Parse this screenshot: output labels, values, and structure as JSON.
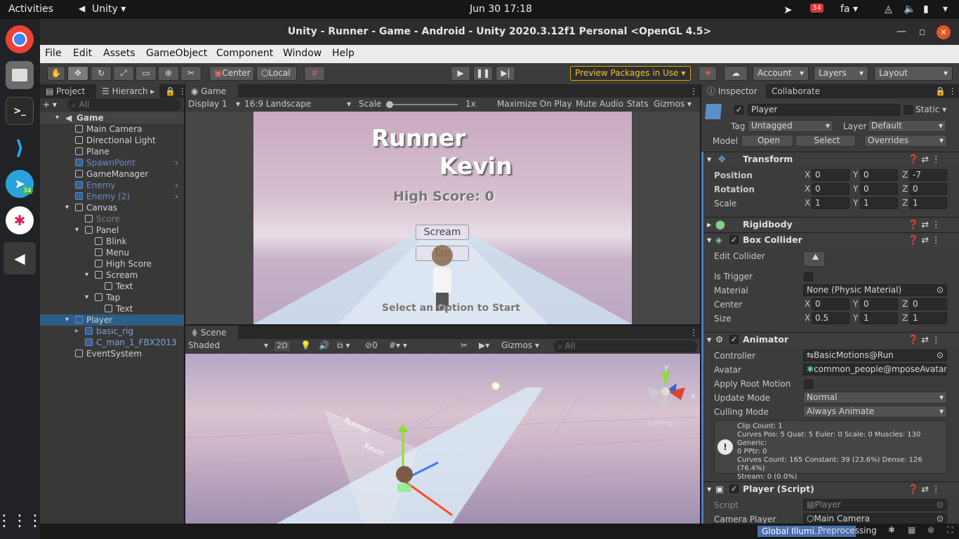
{
  "system": {
    "activities": "Activities",
    "app_name": "Unity",
    "datetime": "Jun 30  17:18",
    "badge": "34",
    "lang": "fa"
  },
  "dock": {
    "telegram_badge": "34"
  },
  "window": {
    "title": "Unity - Runner - Game - Android - Unity 2020.3.12f1 Personal <OpenGL 4.5>"
  },
  "menu": [
    "File",
    "Edit",
    "Assets",
    "GameObject",
    "Component",
    "Window",
    "Help"
  ],
  "toolbar": {
    "center": "Center",
    "local": "Local",
    "preview_packages": "Preview Packages in Use",
    "account": "Account",
    "layers": "Layers",
    "layout": "Layout"
  },
  "hierarchy": {
    "tabs": [
      "Project",
      "Hierarch"
    ],
    "search_placeholder": "All",
    "rows": [
      {
        "label": "Game",
        "style": "scene"
      },
      {
        "label": "Main Camera"
      },
      {
        "label": "Directional Light"
      },
      {
        "label": "Plane"
      },
      {
        "label": "SpawnPoint",
        "style": "prefab"
      },
      {
        "label": "GameManager"
      },
      {
        "label": "Enemy",
        "style": "prefab"
      },
      {
        "label": "Enemy (2)",
        "style": "prefab"
      },
      {
        "label": "Canvas"
      },
      {
        "label": "Score",
        "style": "disabled"
      },
      {
        "label": "Panel"
      },
      {
        "label": "Blink"
      },
      {
        "label": "Menu"
      },
      {
        "label": "High Score"
      },
      {
        "label": "Scream"
      },
      {
        "label": "Text"
      },
      {
        "label": "Tap"
      },
      {
        "label": "Text"
      },
      {
        "label": "Player",
        "style": "selected"
      },
      {
        "label": "basic_rig",
        "style": "prefab"
      },
      {
        "label": "C_man_1_FBX2013",
        "style": "prefab"
      },
      {
        "label": "EventSystem"
      }
    ]
  },
  "game": {
    "tab": "Game",
    "display": "Display 1",
    "aspect": "16:9 Landscape",
    "scale_label": "Scale",
    "scale_value": "1x",
    "maximize": "Maximize On Play",
    "mute": "Mute Audio",
    "stats": "Stats",
    "gizmos": "Gizmos",
    "title1": "Runner",
    "title2": "Kevin",
    "high_score": "High Score: 0",
    "scream_btn": "Scream",
    "tap_btn": "Tap",
    "select_hint": "Select an Option to Start"
  },
  "scene": {
    "tab": "Scene",
    "shading": "Shaded",
    "mode2d": "2D",
    "hidden_count": "0",
    "gizmos": "Gizmos",
    "search_placeholder": "All",
    "persp": "<Persp",
    "axis_x": "x",
    "axis_y": "y",
    "world_title1": "Runner",
    "world_title2": "Kevin"
  },
  "inspector": {
    "tabs": [
      "Inspector",
      "Collaborate"
    ],
    "object_name": "Player",
    "static_label": "Static",
    "tag_label": "Tag",
    "tag_value": "Untagged",
    "layer_label": "Layer",
    "layer_value": "Default",
    "model_label": "Model",
    "open": "Open",
    "select": "Select",
    "overrides": "Overrides",
    "transform": {
      "title": "Transform",
      "position": {
        "label": "Position",
        "x": "0",
        "y": "0",
        "z": "-7"
      },
      "rotation": {
        "label": "Rotation",
        "x": "0",
        "y": "0",
        "z": "0"
      },
      "scale": {
        "label": "Scale",
        "x": "1",
        "y": "1",
        "z": "1"
      }
    },
    "rigidbody": {
      "title": "Rigidbody"
    },
    "box_collider": {
      "title": "Box Collider",
      "edit_collider": "Edit Collider",
      "is_trigger": "Is Trigger",
      "material_label": "Material",
      "material_value": "None (Physic Material)",
      "center": {
        "label": "Center",
        "x": "0",
        "y": "0",
        "z": "0"
      },
      "size": {
        "label": "Size",
        "x": "0.5",
        "y": "1",
        "z": "1"
      }
    },
    "animator": {
      "title": "Animator",
      "controller_label": "Controller",
      "controller_value": "BasicMotions@Run",
      "avatar_label": "Avatar",
      "avatar_value": "common_people@mposeAvatar",
      "root_motion": "Apply Root Motion",
      "update_label": "Update Mode",
      "update_value": "Normal",
      "culling_label": "Culling Mode",
      "culling_value": "Always Animate",
      "info": [
        "Clip Count: 1",
        "Curves Pos: 5 Quat: 5 Euler: 0 Scale: 0 Muscles: 130 Generic:",
        "0 PPtr: 0",
        "Curves Count: 165 Constant: 39 (23.6%) Dense: 126 (76.4%)",
        "Stream: 0 (0.0%)"
      ]
    },
    "player_script": {
      "title": "Player (Script)",
      "script_label": "Script",
      "script_value": "Player",
      "camera_label": "Camera Player",
      "camera_value": "Main Camera"
    }
  },
  "status": {
    "gi": "Global Illumi...",
    "preprocessing": "Preprocessing"
  },
  "axis_letters": {
    "x": "X",
    "y": "Y",
    "z": "Z"
  }
}
